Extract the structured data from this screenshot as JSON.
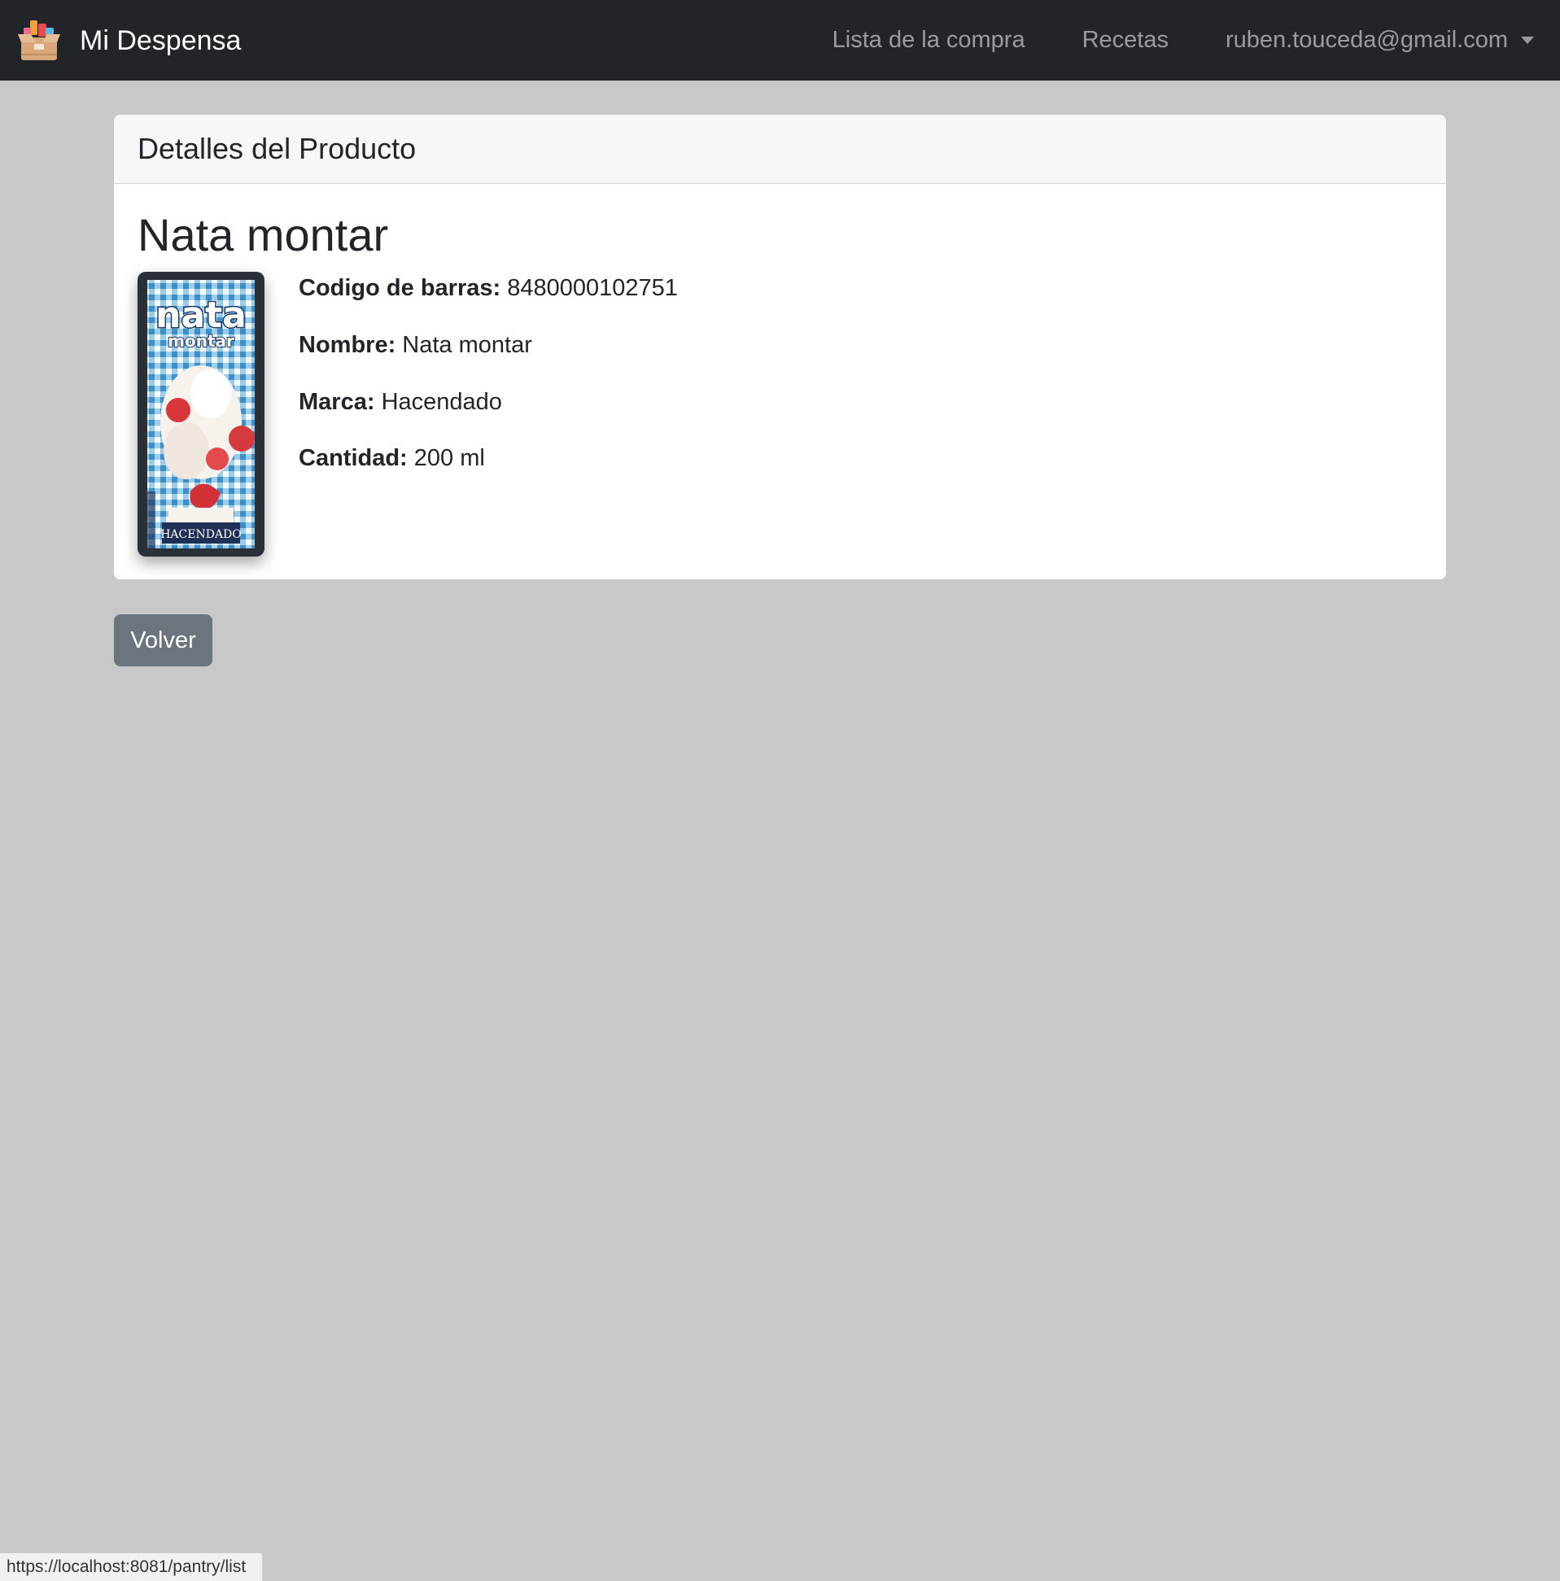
{
  "navbar": {
    "brand_text": "Mi Despensa",
    "logo_icon": "pantry-box-icon",
    "links": {
      "shopping_list": "Lista de la compra",
      "recipes": "Recetas",
      "user_email": "ruben.touceda@gmail.com"
    }
  },
  "card": {
    "header_title": "Detalles del Producto",
    "product_title": "Nata montar",
    "image": {
      "brand_text": "nata",
      "subtitle_text": "montar",
      "bottom_text": "HACENDADO"
    },
    "details": {
      "barcode_label": "Codigo de barras:",
      "barcode_value": "8480000102751",
      "name_label": "Nombre:",
      "name_value": "Nata montar",
      "brand_label": "Marca:",
      "brand_value": "Hacendado",
      "quantity_label": "Cantidad:",
      "quantity_value": "200 ml"
    }
  },
  "actions": {
    "back_label": "Volver"
  },
  "status_bar": {
    "url": "https://localhost:8081/pantry/list"
  },
  "colors": {
    "navbar_bg": "#212529",
    "page_bg": "#c8c8c8",
    "button_secondary": "#6c757d",
    "card_header_bg": "#f7f7f7"
  }
}
